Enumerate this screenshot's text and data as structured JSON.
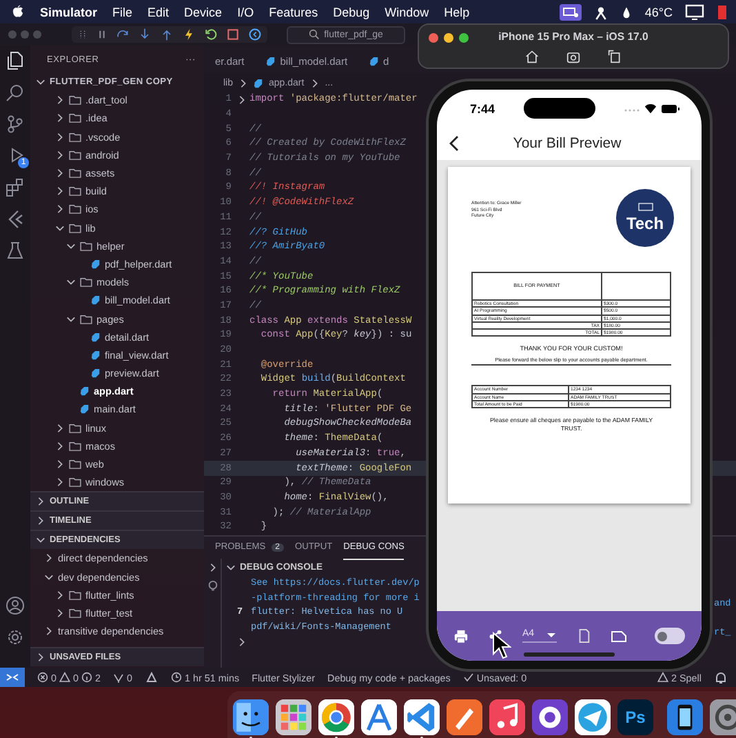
{
  "menu_bar": {
    "app": "Simulator",
    "items": [
      "File",
      "Edit",
      "Device",
      "I/O",
      "Features",
      "Debug",
      "Window",
      "Help"
    ],
    "temperature": "46°C"
  },
  "vscode": {
    "search": "flutter_pdf_ge",
    "activity_bar": {
      "debug_badge": "1"
    },
    "explorer": {
      "title": "EXPLORER",
      "more": "···",
      "root": "FLUTTER_PDF_GEN COPY",
      "tree": [
        {
          "name": ".dart_tool",
          "kind": "folder",
          "expanded": false,
          "selected": false
        },
        {
          "name": ".idea",
          "kind": "folder",
          "expanded": false,
          "selected": false
        },
        {
          "name": ".vscode",
          "kind": "folder",
          "expanded": false,
          "selected": false
        },
        {
          "name": "android",
          "kind": "folder",
          "expanded": false,
          "selected": false
        },
        {
          "name": "assets",
          "kind": "folder",
          "expanded": false,
          "selected": false
        },
        {
          "name": "build",
          "kind": "folder",
          "expanded": false,
          "selected": false
        },
        {
          "name": "ios",
          "kind": "folder",
          "expanded": false,
          "selected": false
        },
        {
          "name": "lib",
          "kind": "folder",
          "expanded": true,
          "selected": false,
          "children": [
            {
              "name": "helper",
              "kind": "folder",
              "expanded": true,
              "selected": false,
              "children": [
                {
                  "name": "pdf_helper.dart",
                  "kind": "dart",
                  "selected": false
                }
              ]
            },
            {
              "name": "models",
              "kind": "folder",
              "expanded": true,
              "selected": false,
              "children": [
                {
                  "name": "bill_model.dart",
                  "kind": "dart",
                  "selected": false
                }
              ]
            },
            {
              "name": "pages",
              "kind": "folder",
              "expanded": true,
              "selected": false,
              "children": [
                {
                  "name": "detail.dart",
                  "kind": "dart",
                  "selected": false
                },
                {
                  "name": "final_view.dart",
                  "kind": "dart",
                  "selected": false
                },
                {
                  "name": "preview.dart",
                  "kind": "dart",
                  "selected": false
                }
              ]
            },
            {
              "name": "app.dart",
              "kind": "dart",
              "selected": true
            },
            {
              "name": "main.dart",
              "kind": "dart",
              "selected": false
            }
          ]
        },
        {
          "name": "linux",
          "kind": "folder",
          "expanded": false,
          "selected": false
        },
        {
          "name": "macos",
          "kind": "folder",
          "expanded": false,
          "selected": false
        },
        {
          "name": "web",
          "kind": "folder",
          "expanded": false,
          "selected": false
        },
        {
          "name": "windows",
          "kind": "folder",
          "expanded": false,
          "selected": false
        }
      ]
    },
    "sections": [
      {
        "label": "OUTLINE",
        "expanded": false
      },
      {
        "label": "TIMELINE",
        "expanded": false
      },
      {
        "label": "DEPENDENCIES",
        "expanded": true,
        "children": [
          {
            "name": "direct dependencies",
            "kind": "group",
            "expanded": false,
            "selected": false
          },
          {
            "name": "dev dependencies",
            "kind": "group",
            "expanded": true,
            "selected": false,
            "children": [
              {
                "name": "flutter_lints",
                "kind": "folder",
                "expanded": false,
                "selected": false
              },
              {
                "name": "flutter_test",
                "kind": "folder",
                "expanded": false,
                "selected": false
              }
            ]
          },
          {
            "name": "transitive dependencies",
            "kind": "group",
            "expanded": false,
            "selected": false
          }
        ]
      },
      {
        "label": "UNSAVED FILES",
        "expanded": false
      }
    ],
    "tabs": [
      {
        "label": "er.dart",
        "selected": false
      },
      {
        "label": "bill_model.dart",
        "selected": false
      },
      {
        "label": "d",
        "selected": false
      }
    ],
    "breadcrumb": [
      "lib",
      "app.dart",
      "..."
    ],
    "code": [
      {
        "n": "1",
        "folded": true,
        "current": false,
        "tokens": [
          {
            "kind": "kw",
            "text": "import "
          },
          {
            "kind": "str",
            "text": "'package:flutter/mater"
          }
        ]
      },
      {
        "n": "4",
        "folded": false,
        "current": false
      },
      {
        "n": "5",
        "folded": false,
        "current": false,
        "tokens": [
          {
            "kind": "cmt",
            "text": "//"
          }
        ]
      },
      {
        "n": "6",
        "folded": false,
        "current": false,
        "tokens": [
          {
            "kind": "cmt",
            "text": "// Created by CodeWithFlexZ"
          }
        ]
      },
      {
        "n": "7",
        "folded": false,
        "current": false,
        "tokens": [
          {
            "kind": "cmt",
            "text": "// Tutorials on my YouTube"
          }
        ]
      },
      {
        "n": "8",
        "folded": false,
        "current": false,
        "tokens": [
          {
            "kind": "cmt",
            "text": "//"
          }
        ]
      },
      {
        "n": "9",
        "folded": false,
        "current": false,
        "tokens": [
          {
            "kind": "alert",
            "text": "//! Instagram"
          }
        ]
      },
      {
        "n": "10",
        "folded": false,
        "current": false,
        "tokens": [
          {
            "kind": "alert",
            "text": "//! @CodeWithFlexZ"
          }
        ]
      },
      {
        "n": "11",
        "folded": false,
        "current": false,
        "tokens": [
          {
            "kind": "cmt",
            "text": "//"
          }
        ]
      },
      {
        "n": "12",
        "folded": false,
        "current": false,
        "tokens": [
          {
            "kind": "query",
            "text": "//? GitHub"
          }
        ]
      },
      {
        "n": "13",
        "folded": false,
        "current": false,
        "tokens": [
          {
            "kind": "query",
            "text": "//? AmirByat0"
          }
        ]
      },
      {
        "n": "14",
        "folded": false,
        "current": false,
        "tokens": [
          {
            "kind": "cmt",
            "text": "//"
          }
        ]
      },
      {
        "n": "15",
        "folded": false,
        "current": false,
        "tokens": [
          {
            "kind": "highlight",
            "text": "//* YouTube"
          }
        ]
      },
      {
        "n": "16",
        "folded": false,
        "current": false,
        "tokens": [
          {
            "kind": "highlight",
            "text": "//* Programming with FlexZ"
          }
        ]
      },
      {
        "n": "17",
        "folded": false,
        "current": false,
        "tokens": [
          {
            "kind": "cmt",
            "text": "//"
          }
        ]
      },
      {
        "n": "18",
        "folded": false,
        "current": false,
        "tokens": [
          {
            "kind": "kw",
            "text": "class "
          },
          {
            "kind": "cls",
            "text": "App "
          },
          {
            "kind": "kw",
            "text": "extends "
          },
          {
            "kind": "cls",
            "text": "StatelessW"
          }
        ]
      },
      {
        "n": "19",
        "folded": false,
        "current": false,
        "tokens": [
          {
            "kind": "kw",
            "text": "  const "
          },
          {
            "kind": "cls",
            "text": "App"
          },
          {
            "kind": "plain",
            "text": "({"
          },
          {
            "kind": "cls",
            "text": "Key"
          },
          {
            "kind": "plain",
            "text": "? "
          },
          {
            "kind": "prop",
            "text": "key"
          },
          {
            "kind": "plain",
            "text": "}) : su"
          }
        ]
      },
      {
        "n": "20",
        "folded": false,
        "current": false
      },
      {
        "n": "21",
        "folded": false,
        "current": false,
        "tokens": [
          {
            "kind": "ann",
            "text": "  @override"
          }
        ]
      },
      {
        "n": "22",
        "folded": false,
        "current": false,
        "tokens": [
          {
            "kind": "cls",
            "text": "  Widget "
          },
          {
            "kind": "fn",
            "text": "build"
          },
          {
            "kind": "plain",
            "text": "("
          },
          {
            "kind": "cls",
            "text": "BuildContext"
          }
        ]
      },
      {
        "n": "23",
        "folded": false,
        "current": false,
        "tokens": [
          {
            "kind": "kw",
            "text": "    return "
          },
          {
            "kind": "cls",
            "text": "MaterialApp"
          },
          {
            "kind": "plain",
            "text": "("
          }
        ]
      },
      {
        "n": "24",
        "folded": false,
        "current": false,
        "tokens": [
          {
            "kind": "prop",
            "text": "      title"
          },
          {
            "kind": "plain",
            "text": ": "
          },
          {
            "kind": "str",
            "text": "'Flutter PDF Ge"
          }
        ]
      },
      {
        "n": "25",
        "folded": false,
        "current": false,
        "tokens": [
          {
            "kind": "prop",
            "text": "      debugShowCheckedModeBa"
          }
        ]
      },
      {
        "n": "26",
        "folded": false,
        "current": false,
        "tokens": [
          {
            "kind": "prop",
            "text": "      theme"
          },
          {
            "kind": "plain",
            "text": ": "
          },
          {
            "kind": "cls",
            "text": "ThemeData"
          },
          {
            "kind": "plain",
            "text": "("
          }
        ]
      },
      {
        "n": "27",
        "folded": false,
        "current": false,
        "tokens": [
          {
            "kind": "prop",
            "text": "        useMaterial3"
          },
          {
            "kind": "plain",
            "text": ": "
          },
          {
            "kind": "kw",
            "text": "true"
          },
          {
            "kind": "plain",
            "text": ","
          }
        ]
      },
      {
        "n": "28",
        "folded": false,
        "current": true,
        "tokens": [
          {
            "kind": "prop",
            "text": "        textTheme"
          },
          {
            "kind": "plain",
            "text": ": "
          },
          {
            "kind": "cls",
            "text": "GoogleFon"
          }
        ]
      },
      {
        "n": "29",
        "folded": false,
        "current": false,
        "tokens": [
          {
            "kind": "plain",
            "text": "      ), "
          },
          {
            "kind": "cmt",
            "text": "// ThemeData"
          }
        ]
      },
      {
        "n": "30",
        "folded": false,
        "current": false,
        "tokens": [
          {
            "kind": "prop",
            "text": "      home"
          },
          {
            "kind": "plain",
            "text": ": "
          },
          {
            "kind": "cls",
            "text": "FinalView"
          },
          {
            "kind": "plain",
            "text": "(),"
          }
        ]
      },
      {
        "n": "31",
        "folded": false,
        "current": false,
        "tokens": [
          {
            "kind": "plain",
            "text": "    ); "
          },
          {
            "kind": "cmt",
            "text": "// MaterialApp"
          }
        ]
      },
      {
        "n": "32",
        "folded": false,
        "current": false,
        "tokens": [
          {
            "kind": "plain",
            "text": "  }"
          }
        ]
      }
    ],
    "panel": {
      "tabs": [
        {
          "label": "PROBLEMS",
          "badge": "2",
          "selected": false
        },
        {
          "label": "OUTPUT",
          "selected": false
        },
        {
          "label": "DEBUG CONS",
          "selected": true
        }
      ],
      "console_title": "DEBUG CONSOLE",
      "lines": [
        {
          "kind": "link",
          "text": "See https://docs.flutter.dev/p"
        },
        {
          "kind": "link",
          "text": "-platform-threading for more i"
        },
        {
          "kind": "log",
          "count": "7",
          "text": "flutter: Helvetica has no U"
        },
        {
          "kind": "log",
          "text": "pdf/wiki/Fonts-Management"
        }
      ],
      "overflow": [
        "and",
        "rt_"
      ]
    },
    "status_bar": {
      "errors": "0",
      "warnings": "0",
      "infos": "2",
      "ports": "0",
      "timer": "1 hr 51 mins",
      "items": [
        "Flutter Stylizer",
        "Debug my code + packages"
      ],
      "unsaved": "Unsaved: 0",
      "spell": "2 Spell"
    }
  },
  "simulator": {
    "title": "iPhone 15 Pro Max – iOS 17.0",
    "phone": {
      "time": "7:44",
      "app_title": "Your Bill Preview",
      "pdf": {
        "address": [
          "Attention to: Grace Miller",
          "961 Sci-Fi Blvd",
          "Future City"
        ],
        "logo": "Tech",
        "bill_title": "BILL FOR PAYMENT",
        "items": [
          {
            "name": "Robotics Consultation",
            "amount": "$300.0"
          },
          {
            "name": "AI Programming",
            "amount": "$500.0"
          },
          {
            "name": "Virtual Reality Development",
            "amount": "$1,000.0"
          }
        ],
        "tax": {
          "label": "TAX",
          "amount": "$180.00"
        },
        "total": {
          "label": "TOTAL",
          "amount": "$1980.00"
        },
        "thanks": "THANK YOU FOR YOUR CUSTOM!",
        "forward_note": "Please forward the below slip to your accounts payable department.",
        "slip": [
          {
            "label": "Account Number",
            "value": "1234 1234"
          },
          {
            "label": "Account Name",
            "value": "ADAM FAMILY TRUST"
          },
          {
            "label": "Total Amount to be Paid",
            "value": "$1980.00"
          }
        ],
        "closing": "Please ensure all cheques are payable to the ADAM FAMILY TRUST."
      },
      "toolbar": {
        "page_size": "A4",
        "landscape": {
          "on": false
        }
      }
    }
  },
  "dock": {
    "apps": [
      {
        "kind": "finder",
        "running": true
      },
      {
        "kind": "launchpad",
        "running": false
      },
      {
        "kind": "chrome",
        "running": true
      },
      {
        "kind": "compass",
        "running": false
      },
      {
        "kind": "vscode",
        "running": true
      },
      {
        "kind": "pen",
        "running": false
      },
      {
        "kind": "music",
        "running": false
      },
      {
        "kind": "github",
        "running": false
      },
      {
        "kind": "telegram",
        "running": false
      },
      {
        "kind": "photoshop",
        "label": "Ps",
        "running": false
      },
      {
        "kind": "separator"
      },
      {
        "kind": "simulator",
        "running": false
      },
      {
        "kind": "settings",
        "running": false
      }
    ]
  }
}
